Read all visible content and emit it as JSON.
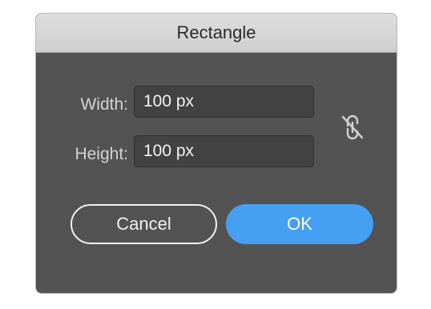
{
  "dialog": {
    "title": "Rectangle",
    "width_label": "Width:",
    "width_value": "100 px",
    "height_label": "Height:",
    "height_value": "100 px",
    "constrain_icon": "unlinked-chain-icon",
    "cancel_label": "Cancel",
    "ok_label": "OK"
  },
  "colors": {
    "dialog_background": "#535353",
    "title_bar": "#d6d6d6",
    "field_background": "#424242",
    "primary_button": "#45a0f4",
    "label_text": "#d2d2d2"
  }
}
